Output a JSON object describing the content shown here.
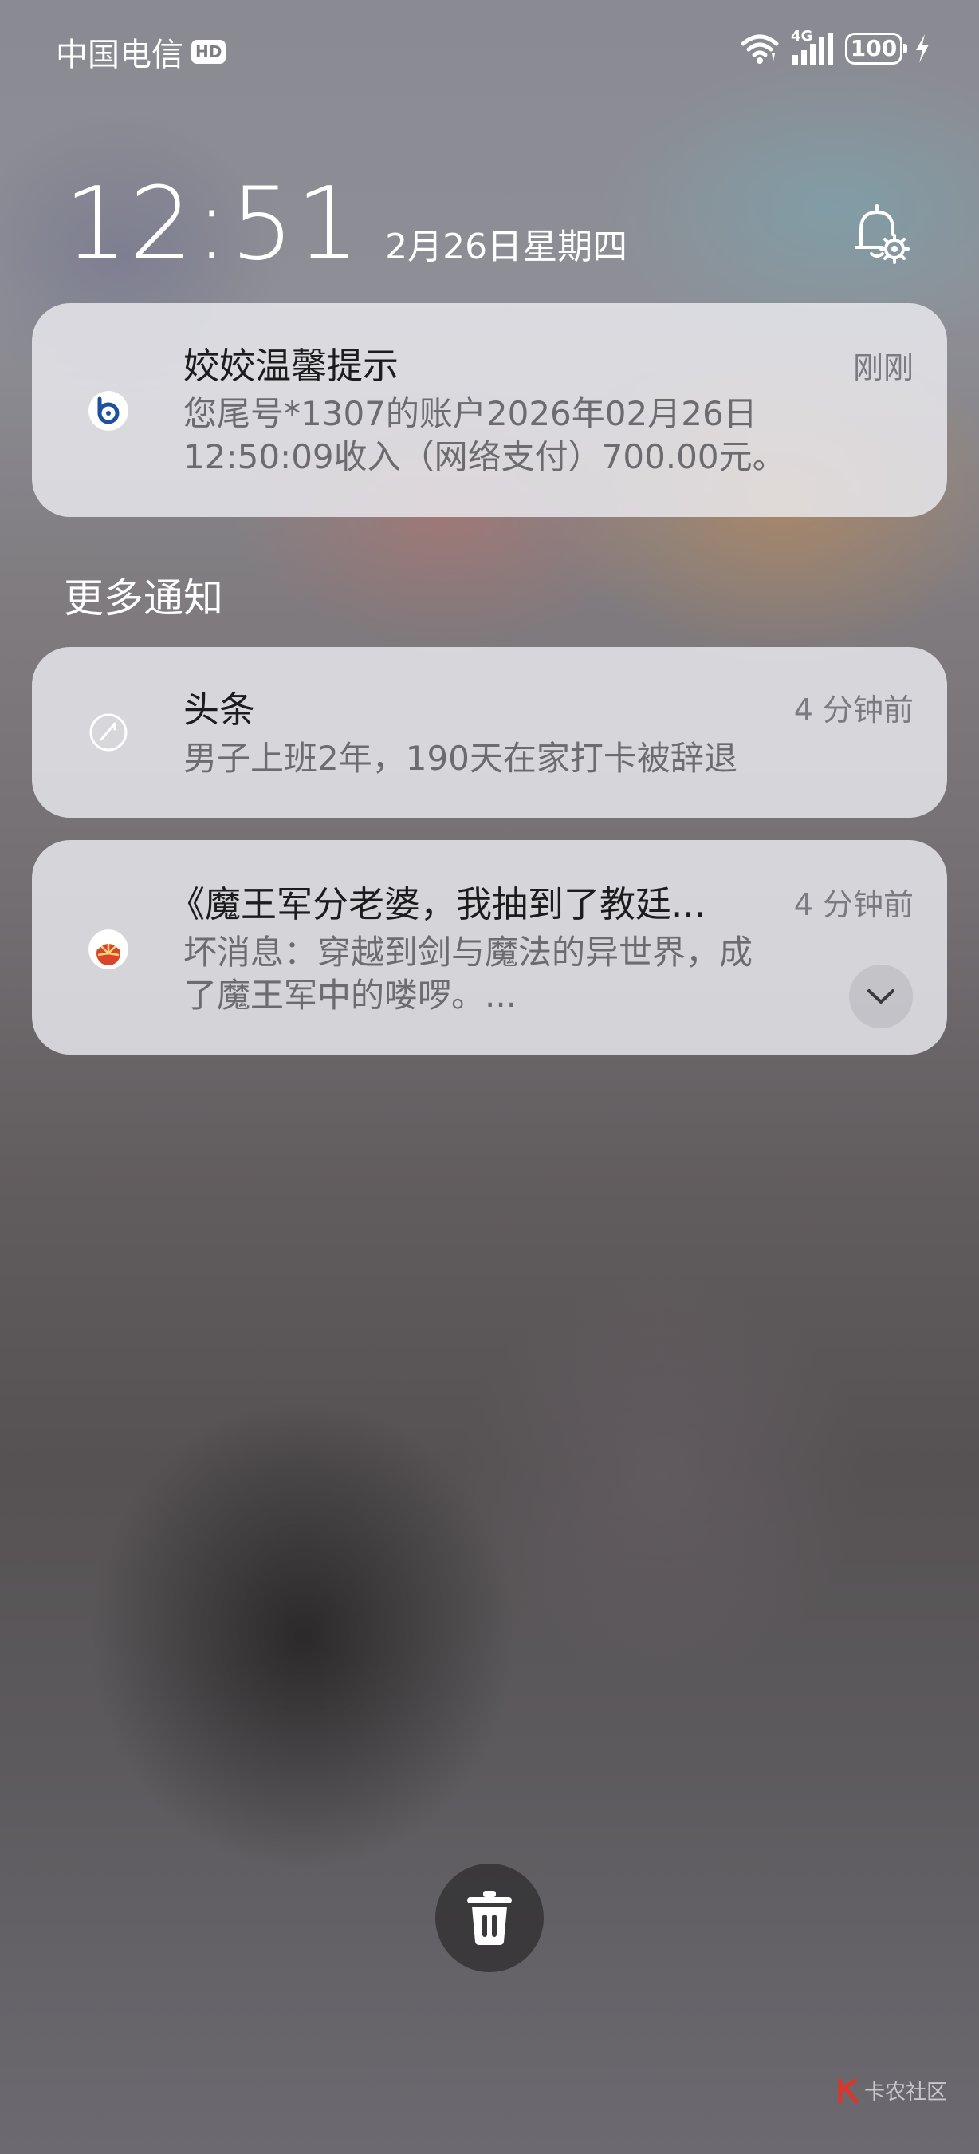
{
  "status_bar": {
    "carrier": "中国电信",
    "hd_badge": "HD",
    "network": "4G",
    "battery_level": "100",
    "icons": [
      "wifi-icon",
      "signal-icon",
      "battery-icon",
      "charging-icon"
    ]
  },
  "lock_screen": {
    "time": "12:51",
    "date": "2月26日星期四",
    "settings_icon": "bell-settings-icon"
  },
  "pinned_notification": {
    "app_icon": "bank-app-icon",
    "title": "姣姣温馨提示",
    "time": "刚刚",
    "body_line1": "您尾号*1307的账户2026年02月26日",
    "body_line2": "12:50:09收入（网络支付）700.00元。"
  },
  "more_notifications_label": "更多通知",
  "notifications": [
    {
      "app_icon": "toutiao-app-icon",
      "title": "头条",
      "time": "4 分钟前",
      "body_line1": "男子上班2年，190天在家打卡被辞退"
    },
    {
      "app_icon": "novel-app-icon",
      "title": "《魔王军分老婆，我抽到了教廷...",
      "time": "4 分钟前",
      "body_line1": "坏消息：穿越到剑与魔法的异世界，成",
      "body_line2": "了魔王军中的喽啰。...",
      "expand_icon": "chevron-down-icon"
    }
  ],
  "clear_all_icon": "trash-icon",
  "watermark": "卡农社区",
  "colors": {
    "card_bg": "#ececf0",
    "text_primary": "#1c1c1e",
    "text_secondary": "#6b6b70",
    "bank_icon_blue": "#1f4fa0",
    "novel_icon_red": "#d9452b"
  }
}
